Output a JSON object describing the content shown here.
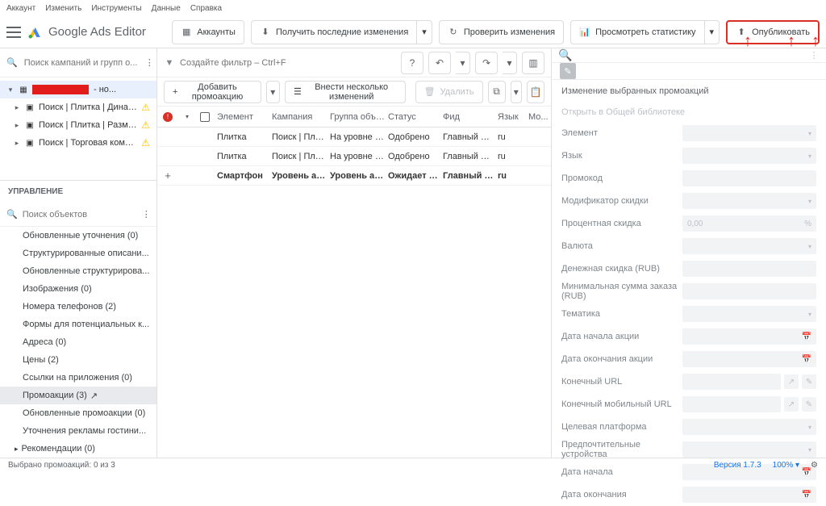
{
  "menubar": [
    "Аккаунт",
    "Изменить",
    "Инструменты",
    "Данные",
    "Справка"
  ],
  "app_title": "Google Ads Editor",
  "topbar": {
    "accounts": "Аккаунты",
    "get_changes": "Получить последние изменения",
    "check_changes": "Проверить изменения",
    "view_stats": "Просмотреть статистику",
    "publish": "Опубликовать"
  },
  "left": {
    "search_placeholder": "Поиск кампаний и групп о...",
    "account_suffix": "- но...",
    "campaigns": [
      {
        "label": "Поиск | Плитка | Динам...",
        "warn": true
      },
      {
        "label": "Поиск | Плитка | Разме...",
        "warn": true
      },
      {
        "label": "Поиск | Торговая компа...",
        "warn": true
      }
    ],
    "mgmt_header": "УПРАВЛЕНИЕ",
    "mgmt_search_placeholder": "Поиск объектов",
    "mgmt_items": [
      "Обновленные уточнения (0)",
      "Структурированные описани...",
      "Обновленные структурирова...",
      "Изображения (0)",
      "Номера телефонов (2)",
      "Формы для потенциальных к...",
      "Адреса (0)",
      "Цены (2)",
      "Ссылки на приложения (0)"
    ],
    "mgmt_active": "Промоакции (3)",
    "mgmt_tail": [
      "Обновленные промоакции (0)",
      "Уточнения рекламы гостини..."
    ],
    "mgmt_rec": "Рекомендации (0)"
  },
  "center": {
    "filter_placeholder": "Создайте фильтр – Ctrl+F",
    "add_btn": "Добавить промоакцию",
    "bulk_btn": "Внести несколько изменений",
    "delete_btn": "Удалить",
    "cols": [
      "",
      "",
      "",
      "Элемент",
      "Кампания",
      "Группа объявл..",
      "Статус",
      "Фид",
      "Язык",
      "Мо..."
    ],
    "rows": [
      {
        "elem": "Плитка",
        "camp": "Поиск | Плитк...",
        "grp": "На уровне ка...",
        "status": "Одобрено",
        "feed": "Главный фид ...",
        "lang": "ru",
        "plus": false,
        "bold": false
      },
      {
        "elem": "Плитка",
        "camp": "Поиск | Плитк...",
        "grp": "На уровне ка...",
        "status": "Одобрено",
        "feed": "Главный фид ...",
        "lang": "ru",
        "plus": false,
        "bold": false
      },
      {
        "elem": "Смартфон",
        "camp": "Уровень акка...",
        "grp": "Уровень акка...",
        "status": "Ожидает расс...",
        "feed": "Главный фид ...",
        "lang": "ru",
        "plus": true,
        "bold": true
      }
    ]
  },
  "right": {
    "title": "Изменение выбранных промоакций",
    "lib_link": "Открыть в Общей библиотеке",
    "fields": [
      {
        "label": "Элемент",
        "type": "drop"
      },
      {
        "label": "Язык",
        "type": "drop"
      },
      {
        "label": "Промокод",
        "type": "text"
      },
      {
        "label": "Модификатор скидки",
        "type": "drop"
      },
      {
        "label": "Процентная скидка",
        "type": "pct",
        "val": "0,00"
      },
      {
        "label": "Валюта",
        "type": "drop"
      },
      {
        "label": "Денежная скидка (RUB)",
        "type": "text"
      },
      {
        "label": "Минимальная сумма заказа (RUB)",
        "type": "text"
      },
      {
        "label": "Тематика",
        "type": "drop"
      },
      {
        "label": "Дата начала акции",
        "type": "date"
      },
      {
        "label": "Дата окончания акции",
        "type": "date"
      },
      {
        "label": "Конечный URL",
        "type": "url"
      },
      {
        "label": "Конечный мобильный URL",
        "type": "url"
      },
      {
        "label": "Целевая платформа",
        "type": "drop"
      },
      {
        "label": "Предпочтительные устройства",
        "type": "drop"
      },
      {
        "label": "Дата начала",
        "type": "date"
      },
      {
        "label": "Дата окончания",
        "type": "date"
      }
    ]
  },
  "statusbar": {
    "selection": "Выбрано промоакций: 0 из 3",
    "version": "Версия 1.7.3",
    "zoom": "100%"
  }
}
